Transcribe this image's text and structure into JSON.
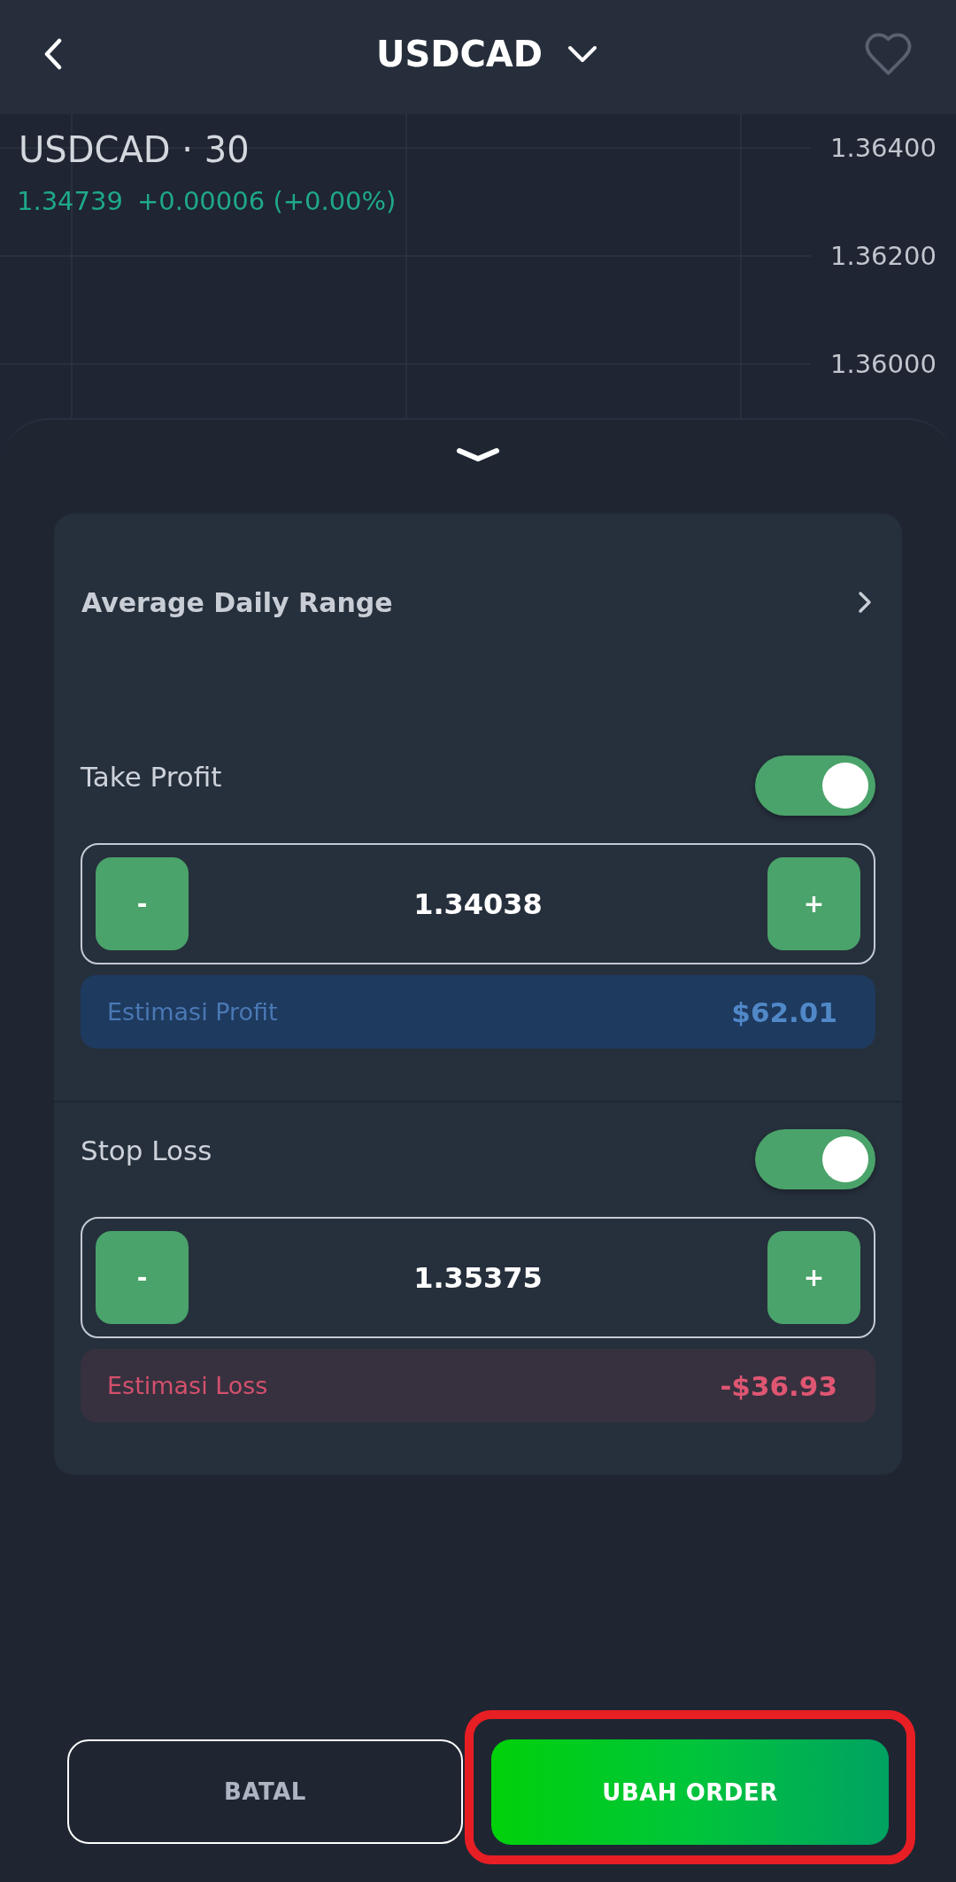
{
  "header": {
    "title": "USDCAD",
    "favorite": false
  },
  "price_chart": {
    "symbol_label": "USDCAD · 30",
    "last_price": "1.34739",
    "change": "+0.00006 (+0.00%)",
    "price_axis": [
      "1.36400",
      "1.36200",
      "1.36000"
    ]
  },
  "card": {
    "range_link": "Average Daily Range",
    "sections": [
      {
        "label": "Take Profit",
        "on": true,
        "decrease": "-",
        "value": "1.34038",
        "increase": "+",
        "estimate": {
          "kind": "profit",
          "label": "Estimasi Profit",
          "amount": "$62.01"
        }
      },
      {
        "label": "Stop Loss",
        "on": true,
        "decrease": "-",
        "value": "1.35375",
        "increase": "+",
        "estimate": {
          "kind": "loss",
          "label": "Estimasi Loss",
          "amount": "-$36.93"
        }
      }
    ]
  },
  "actions": [
    {
      "kind": "secondary",
      "label": "BATAL",
      "highlighted": false
    },
    {
      "kind": "primary",
      "label": "UBAH ORDER",
      "highlighted": true
    }
  ]
}
